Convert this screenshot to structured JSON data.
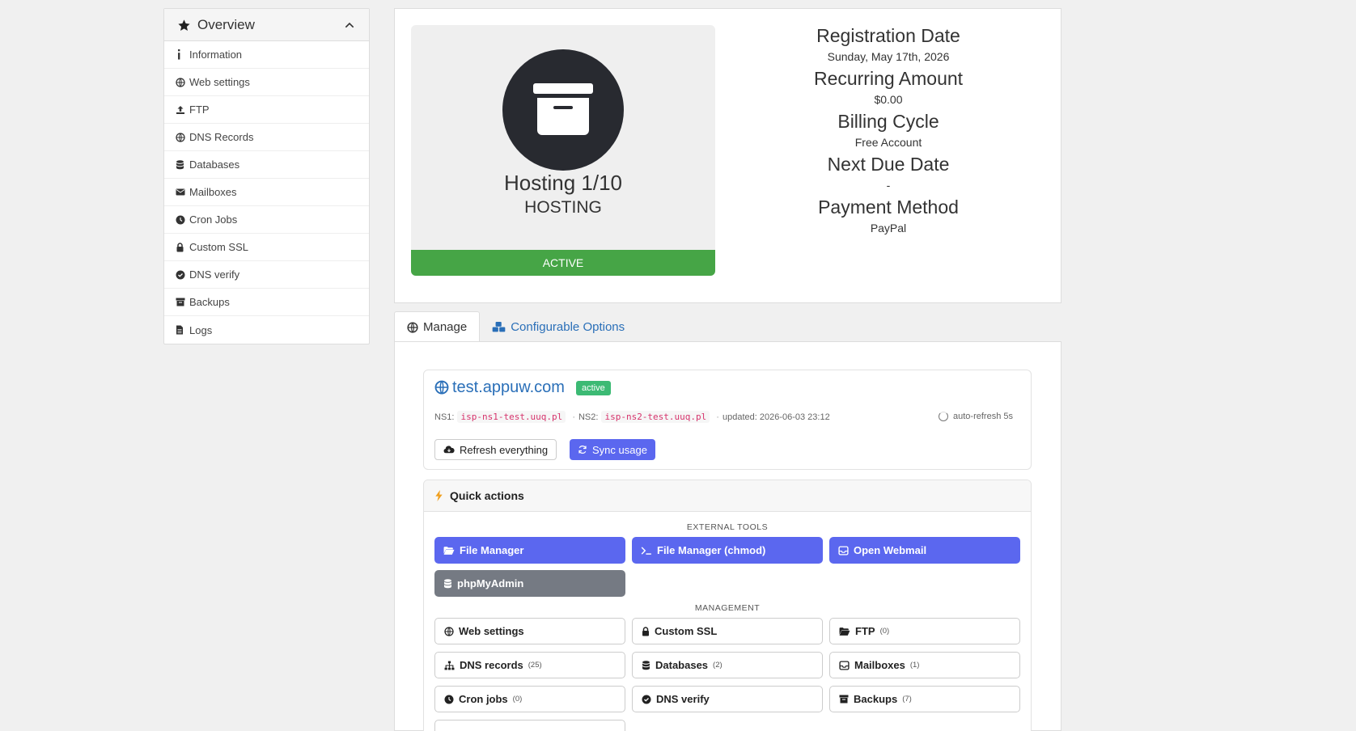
{
  "sidebar": {
    "title": "Overview",
    "items": [
      {
        "label": "Information",
        "icon": "info-icon"
      },
      {
        "label": "Web settings",
        "icon": "globe-icon"
      },
      {
        "label": "FTP",
        "icon": "upload-icon"
      },
      {
        "label": "DNS Records",
        "icon": "globe-icon"
      },
      {
        "label": "Databases",
        "icon": "database-icon"
      },
      {
        "label": "Mailboxes",
        "icon": "envelope-icon"
      },
      {
        "label": "Cron Jobs",
        "icon": "clock-icon"
      },
      {
        "label": "Custom SSL",
        "icon": "lock-icon"
      },
      {
        "label": "DNS verify",
        "icon": "check-circle-icon"
      },
      {
        "label": "Backups",
        "icon": "archive-icon"
      },
      {
        "label": "Logs",
        "icon": "file-icon"
      }
    ]
  },
  "product": {
    "name": "Hosting 1/10",
    "group": "HOSTING",
    "status": "ACTIVE"
  },
  "details": {
    "registration_label": "Registration Date",
    "registration_value": "Sunday, May 17th, 2026",
    "recurring_label": "Recurring Amount",
    "recurring_value": "$0.00",
    "billing_label": "Billing Cycle",
    "billing_value": "Free Account",
    "next_due_label": "Next Due Date",
    "next_due_value": "-",
    "payment_label": "Payment Method",
    "payment_value": "PayPal"
  },
  "tabs": {
    "manage": "Manage",
    "configurable": "Configurable Options"
  },
  "domain": {
    "name": "test.appuw.com",
    "badge": "active",
    "ns1_label": "NS1:",
    "ns1": "isp-ns1-test.uuq.pl",
    "ns2_label": "NS2:",
    "ns2": "isp-ns2-test.uuq.pl",
    "updated": "updated: 2026-06-03 23:12",
    "auto_refresh": "auto-refresh 5s",
    "refresh_btn": "Refresh everything",
    "sync_btn": "Sync usage"
  },
  "quick_actions": {
    "title": "Quick actions",
    "external_label": "EXTERNAL TOOLS",
    "management_label": "MANAGEMENT",
    "external": {
      "file_manager": "File Manager",
      "file_manager_chmod": "File Manager (chmod)",
      "webmail": "Open Webmail",
      "phpmyadmin": "phpMyAdmin"
    },
    "management": {
      "web_settings": "Web settings",
      "custom_ssl": "Custom SSL",
      "ftp": "FTP",
      "ftp_count": "(0)",
      "dns_records": "DNS records",
      "dns_count": "(25)",
      "databases": "Databases",
      "databases_count": "(2)",
      "mailboxes": "Mailboxes",
      "mailboxes_count": "(1)",
      "cron_jobs": "Cron jobs",
      "cron_count": "(0)",
      "dns_verify": "DNS verify",
      "backups": "Backups",
      "backups_count": "(7)"
    }
  },
  "colors": {
    "accent": "#5b67ef",
    "active_green": "#46a546",
    "link_blue": "#2a6fb8",
    "badge_green": "#3cba74"
  }
}
